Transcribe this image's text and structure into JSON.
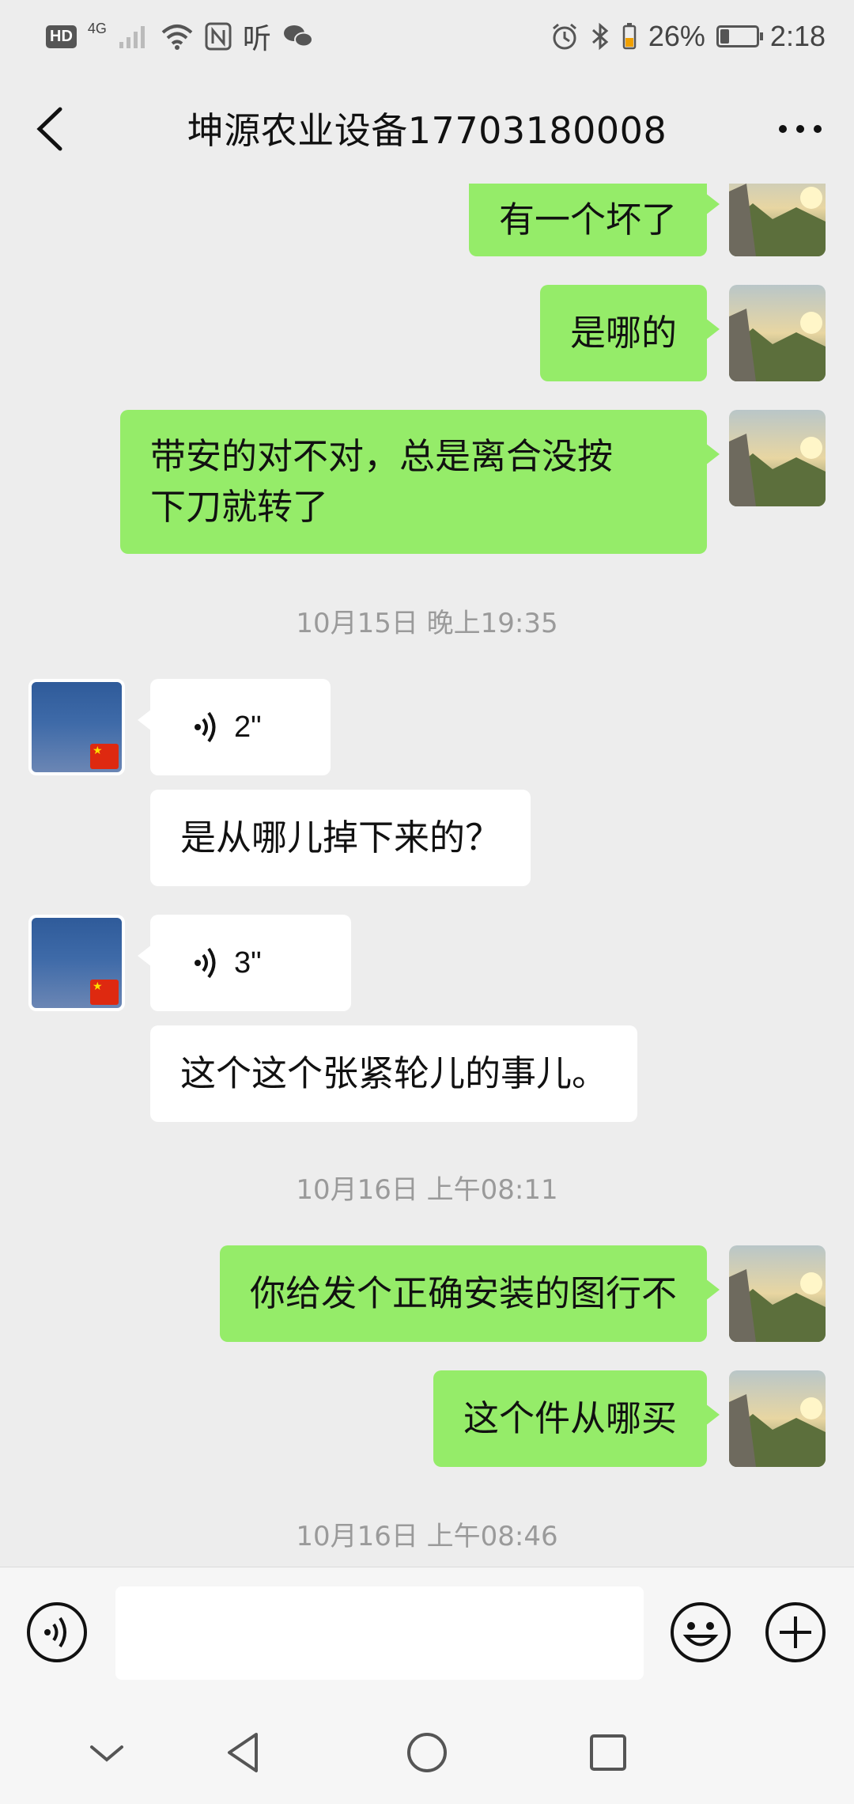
{
  "status_bar": {
    "left_badge": "HD",
    "network": "4G",
    "app_glyph": "听",
    "battery_text": "26%",
    "battery_level": 0.26,
    "time": "2:18"
  },
  "header": {
    "title": "坤源农业设备17703180008"
  },
  "messages": {
    "m1": "有一个坏了",
    "m2": "是哪的",
    "m3_line1": "带安的对不对，总是离合没按",
    "m3_line2": "下刀就转了",
    "ts1": "10月15日 晚上19:35",
    "v1": "2\"",
    "m4": "是从哪儿掉下来的？",
    "v2": "3\"",
    "m5": "这个这个张紧轮儿的事儿。",
    "ts2": "10月16日 上午08:11",
    "m6": "你给发个正确安装的图行不",
    "m7": "这个件从哪买",
    "ts3": "10月16日 上午08:46"
  },
  "input": {
    "placeholder": ""
  },
  "colors": {
    "sent_bubble": "#95ec69",
    "received_bubble": "#ffffff",
    "background": "#ededed"
  },
  "icons": [
    "back-arrow-icon",
    "more-icon",
    "voice-icon",
    "emoji-icon",
    "plus-icon",
    "nav-down-icon",
    "nav-back-icon",
    "nav-home-icon",
    "nav-recents-icon"
  ]
}
